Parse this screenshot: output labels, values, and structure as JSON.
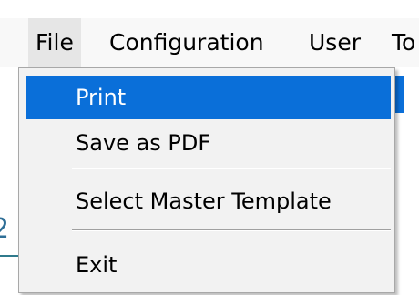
{
  "menubar": {
    "items": [
      {
        "label": "File"
      },
      {
        "label": "Configuration"
      },
      {
        "label": "User"
      },
      {
        "label": "To"
      }
    ]
  },
  "file_menu": {
    "items": [
      {
        "label": "Print",
        "state": "highlighted"
      },
      {
        "label": "Save as PDF"
      },
      {
        "label": "Select Master Template"
      },
      {
        "label": "Exit"
      }
    ]
  },
  "background": {
    "partial_glyph": "2"
  },
  "colors": {
    "highlight": "#0a6fd9",
    "menu_background": "#f2f2f2",
    "menubar_background": "#f8f8f8",
    "background_accent": "#2f6f97"
  }
}
